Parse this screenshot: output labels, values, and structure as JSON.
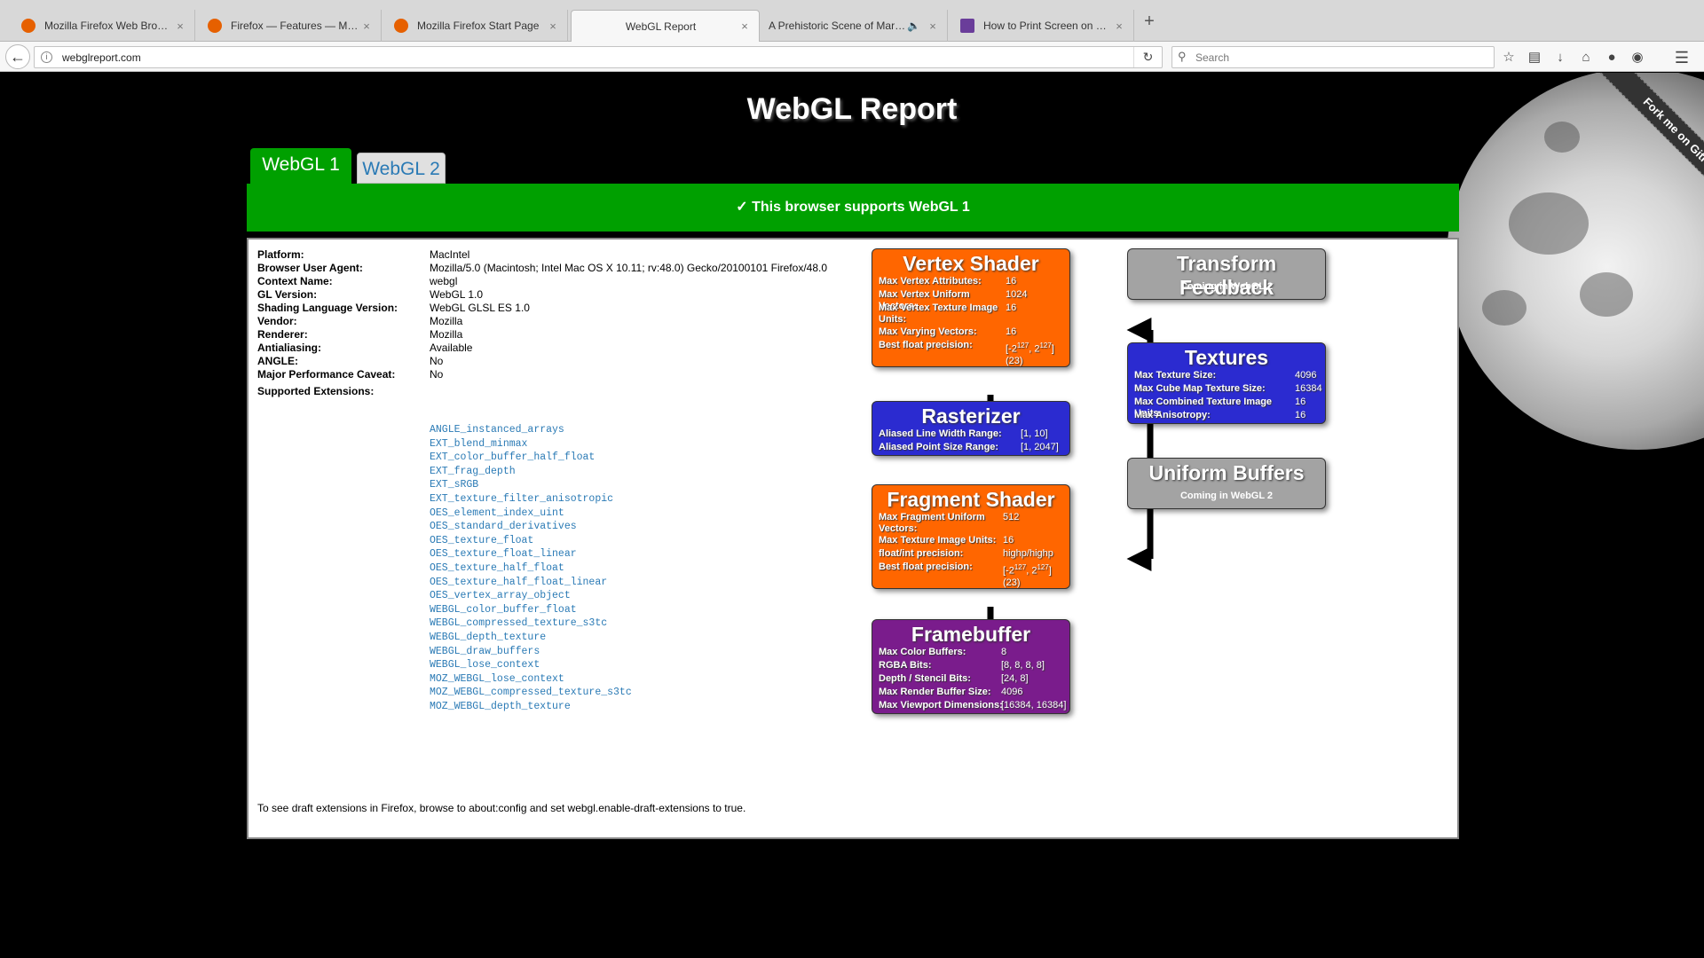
{
  "browser": {
    "tabs": [
      {
        "title": "Mozilla Firefox Web Brows...",
        "active": false,
        "favicon_color": "#e66000"
      },
      {
        "title": "Firefox — Features — Mozilla",
        "active": false,
        "favicon_color": "#e66000"
      },
      {
        "title": "Mozilla Firefox Start Page",
        "active": false,
        "favicon_color": "#e66000"
      },
      {
        "title": "WebGL Report",
        "active": true,
        "favicon_color": ""
      },
      {
        "title": "A Prehistoric Scene of Mars...",
        "active": false,
        "favicon_color": ""
      },
      {
        "title": "How to Print Screen on a M...",
        "active": false,
        "favicon_color": "#6a3d9a"
      }
    ],
    "close_glyph": "×",
    "new_tab_glyph": "+",
    "url": "webglreport.com",
    "search_placeholder": "Search"
  },
  "page": {
    "title": "WebGL Report",
    "fork_ribbon": "Fork me on GitHub",
    "tabs": {
      "webgl1": "WebGL 1",
      "webgl2": "WebGL 2"
    },
    "support_banner": "✓ This browser supports WebGL 1",
    "info": [
      {
        "key": "Platform:",
        "value": "MacIntel"
      },
      {
        "key": "Browser User Agent:",
        "value": "Mozilla/5.0 (Macintosh; Intel Mac OS X 10.11; rv:48.0) Gecko/20100101 Firefox/48.0"
      },
      {
        "key": "Context Name:",
        "value": "webgl"
      },
      {
        "key": "GL Version:",
        "value": "WebGL 1.0"
      },
      {
        "key": "Shading Language Version:",
        "value": "WebGL GLSL ES 1.0"
      },
      {
        "key": "Vendor:",
        "value": "Mozilla"
      },
      {
        "key": "Renderer:",
        "value": "Mozilla"
      },
      {
        "key": "Antialiasing:",
        "value": "Available"
      },
      {
        "key": "ANGLE:",
        "value": "No"
      },
      {
        "key": "Major Performance Caveat:",
        "value": "No"
      }
    ],
    "extensions_label": "Supported Extensions:",
    "extensions": [
      "ANGLE_instanced_arrays",
      "EXT_blend_minmax",
      "EXT_color_buffer_half_float",
      "EXT_frag_depth",
      "EXT_sRGB",
      "EXT_texture_filter_anisotropic",
      "OES_element_index_uint",
      "OES_standard_derivatives",
      "OES_texture_float",
      "OES_texture_float_linear",
      "OES_texture_half_float",
      "OES_texture_half_float_linear",
      "OES_vertex_array_object",
      "WEBGL_color_buffer_float",
      "WEBGL_compressed_texture_s3tc",
      "WEBGL_depth_texture",
      "WEBGL_draw_buffers",
      "WEBGL_lose_context",
      "MOZ_WEBGL_lose_context",
      "MOZ_WEBGL_compressed_texture_s3tc",
      "MOZ_WEBGL_depth_texture"
    ],
    "draft_note": "To see draft extensions in Firefox, browse to about:config and set webgl.enable-draft-extensions to true."
  },
  "pipeline": {
    "vertex_shader": {
      "title": "Vertex Shader",
      "rows": [
        {
          "label": "Max Vertex Attributes:",
          "value": "16"
        },
        {
          "label": "Max Vertex Uniform Vectors:",
          "value": "1024"
        },
        {
          "label": "Max Vertex Texture Image Units:",
          "value": "16"
        },
        {
          "label": "Max Varying Vectors:",
          "value": "16"
        },
        {
          "label": "Best float precision:",
          "value": "[-2^127, 2^127] (23)"
        }
      ]
    },
    "rasterizer": {
      "title": "Rasterizer",
      "rows": [
        {
          "label": "Aliased Line Width Range:",
          "value": "[1, 10]"
        },
        {
          "label": "Aliased Point Size Range:",
          "value": "[1, 2047]"
        }
      ]
    },
    "fragment_shader": {
      "title": "Fragment Shader",
      "rows": [
        {
          "label": "Max Fragment Uniform Vectors:",
          "value": "512"
        },
        {
          "label": "Max Texture Image Units:",
          "value": "16"
        },
        {
          "label": "float/int precision:",
          "value": "highp/highp"
        },
        {
          "label": "Best float precision:",
          "value": "[-2^127, 2^127] (23)"
        }
      ]
    },
    "framebuffer": {
      "title": "Framebuffer",
      "rows": [
        {
          "label": "Max Color Buffers:",
          "value": "8"
        },
        {
          "label": "RGBA Bits:",
          "value": "[8, 8, 8, 8]"
        },
        {
          "label": "Depth / Stencil Bits:",
          "value": "[24, 8]"
        },
        {
          "label": "Max Render Buffer Size:",
          "value": "4096"
        },
        {
          "label": "Max Viewport Dimensions:",
          "value": "[16384, 16384]"
        }
      ]
    },
    "transform_feedback": {
      "title": "Transform Feedback",
      "note": "Coming in WebGL 2"
    },
    "textures": {
      "title": "Textures",
      "rows": [
        {
          "label": "Max Texture Size:",
          "value": "4096"
        },
        {
          "label": "Max Cube Map Texture Size:",
          "value": "16384"
        },
        {
          "label": "Max Combined Texture Image Units:",
          "value": "16"
        },
        {
          "label": "Max Anisotropy:",
          "value": "16"
        }
      ]
    },
    "uniform_buffers": {
      "title": "Uniform Buffers",
      "note": "Coming in WebGL 2"
    },
    "colors": {
      "vertex": "#ff6600",
      "rasterizer": "#2b2bd0",
      "framebuffer": "#7a1c8c",
      "disabled": "#a3a3a3",
      "supported": "#00a000"
    }
  }
}
